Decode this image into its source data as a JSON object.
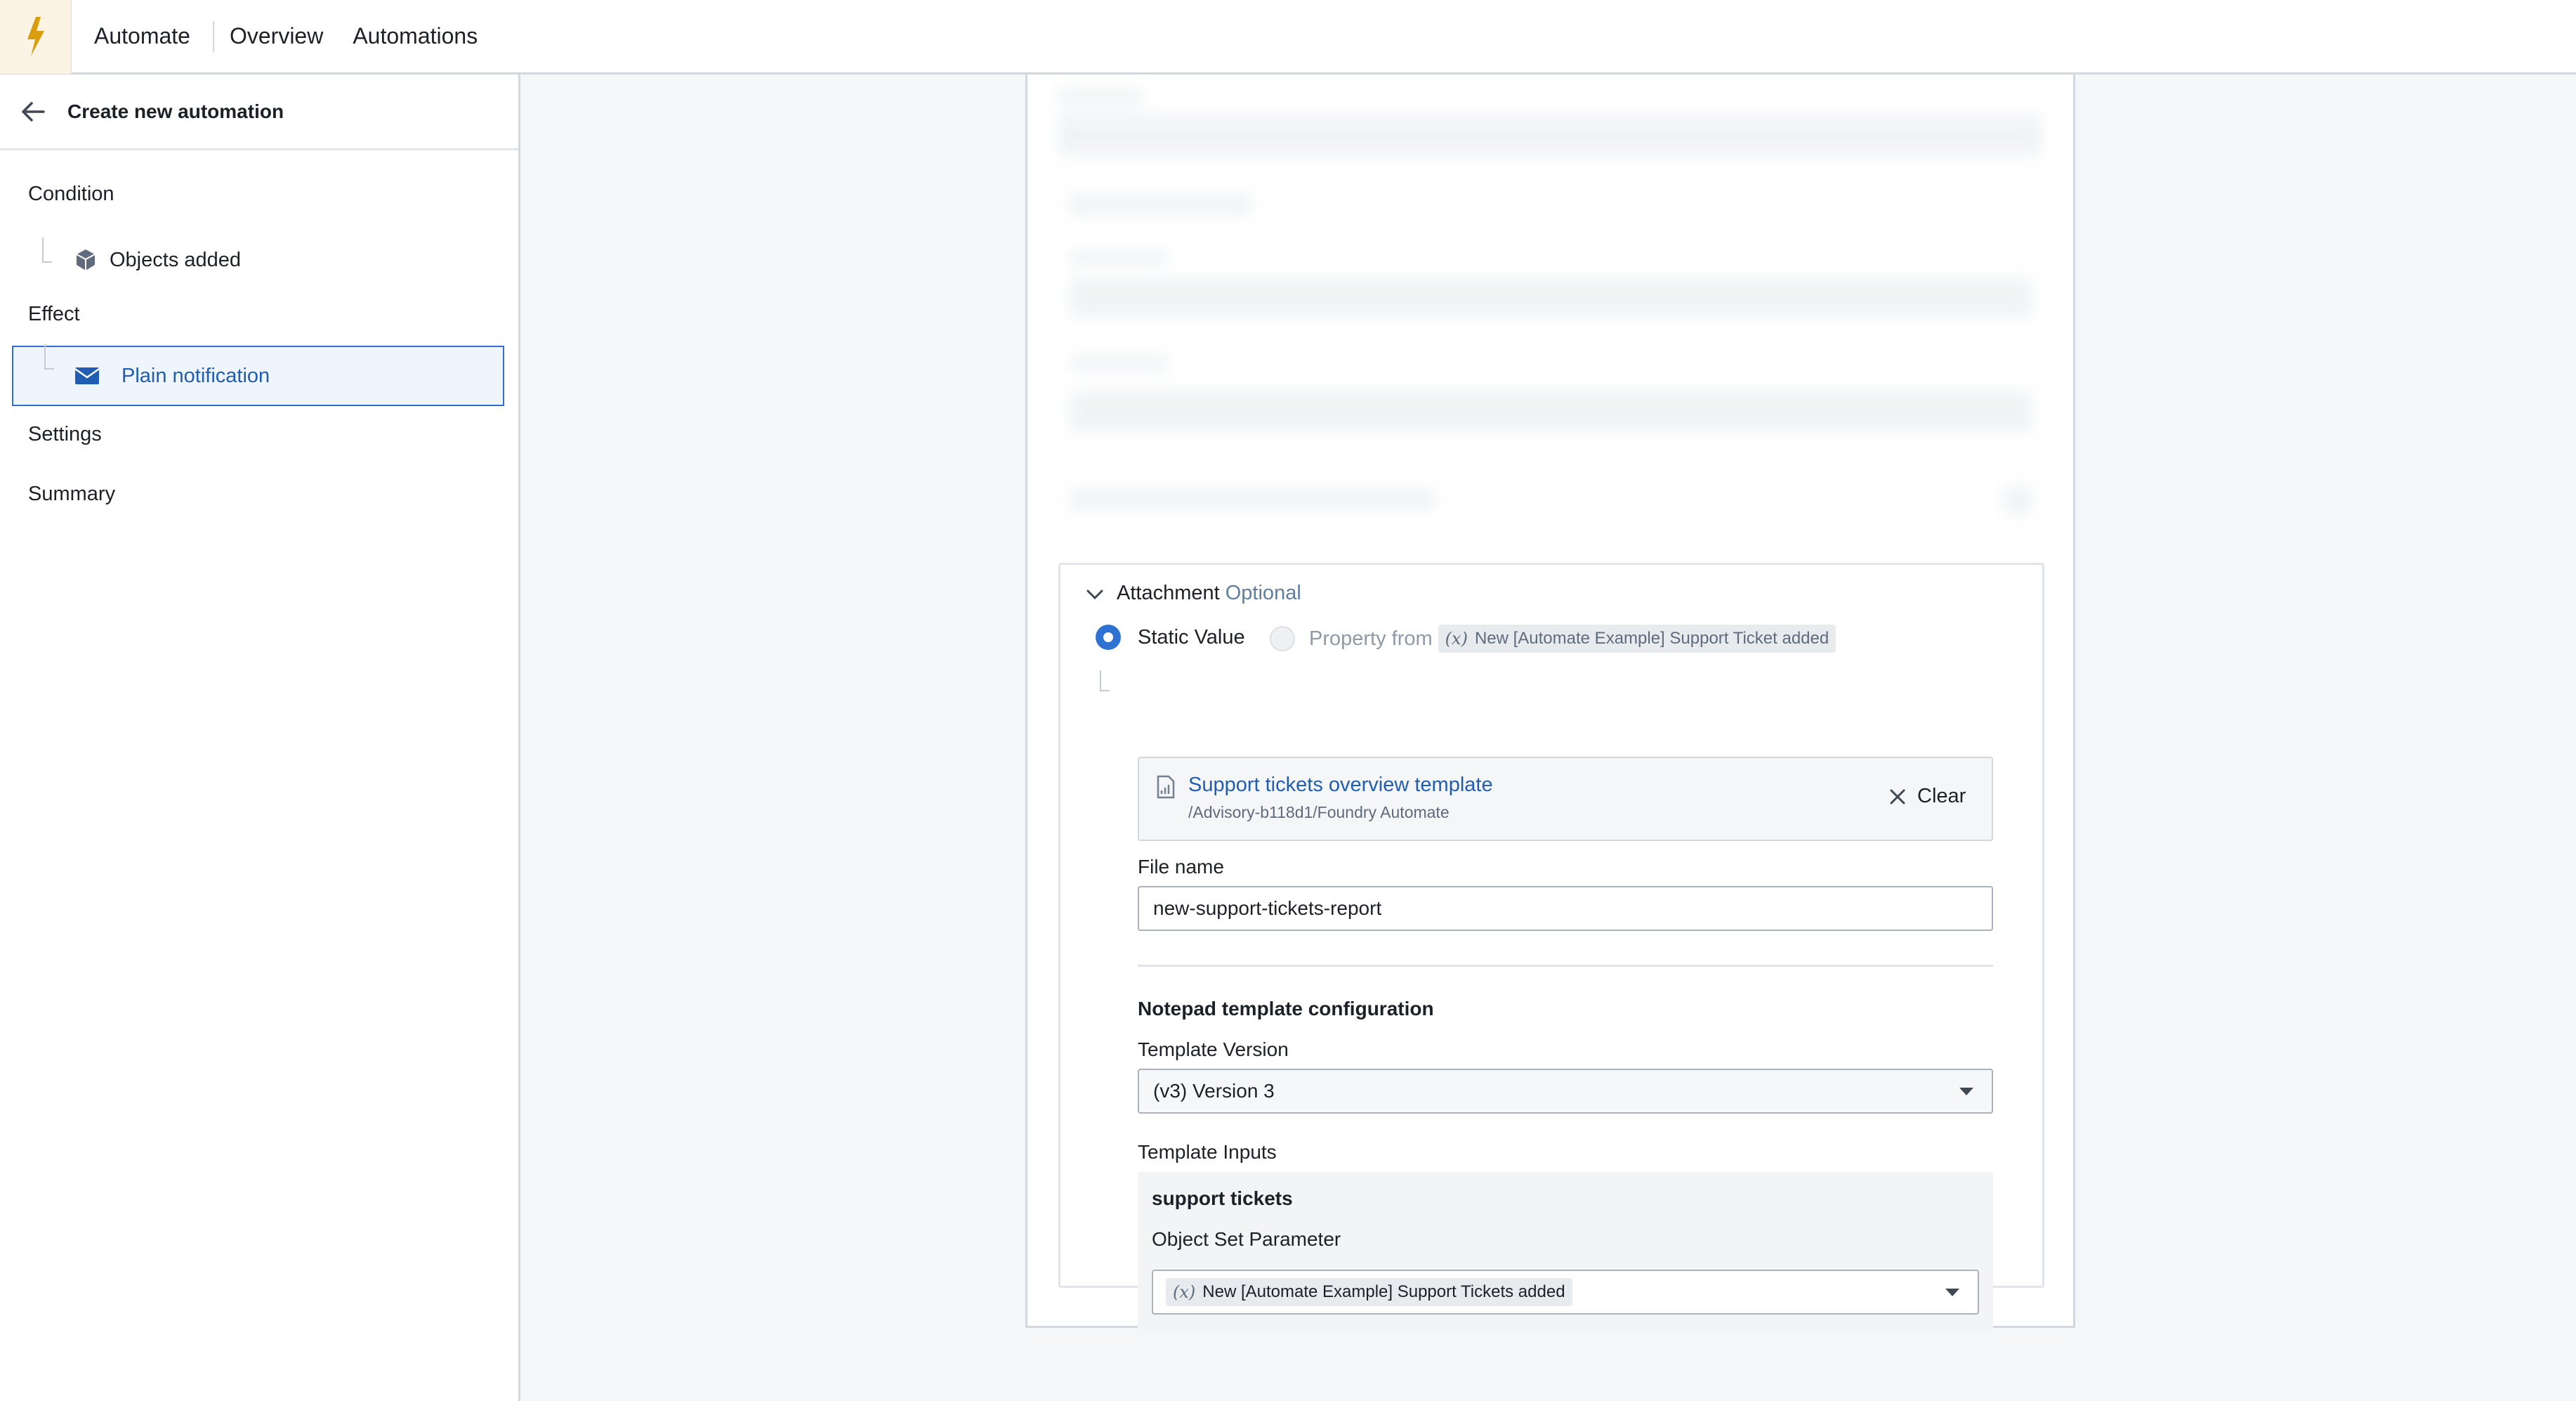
{
  "topbar": {
    "app_name": "Automate",
    "nav": [
      "Overview",
      "Automations"
    ]
  },
  "sidebar": {
    "title": "Create new automation",
    "condition_label": "Condition",
    "condition_item": "Objects added",
    "effect_label": "Effect",
    "effect_item": "Plain notification",
    "settings_label": "Settings",
    "summary_label": "Summary"
  },
  "attachment": {
    "title": "Attachment",
    "optional": "Optional",
    "radio_static": "Static Value",
    "radio_property": "Property from",
    "property_tag": "New [Automate Example] Support Ticket added",
    "variable_glyph": "(x)",
    "file": {
      "name": "Support tickets overview template",
      "path": "/Advisory-b118d1/Foundry Automate",
      "clear_label": "Clear"
    },
    "file_name_label": "File name",
    "file_name_value": "new-support-tickets-report",
    "config_heading": "Notepad template configuration",
    "template_version_label": "Template Version",
    "template_version_value": "(v3) Version 3",
    "template_inputs_label": "Template Inputs",
    "input_group_title": "support tickets",
    "object_set_label": "Object Set Parameter",
    "object_set_value": "New [Automate Example] Support Tickets added"
  },
  "colors": {
    "accent": "#2d72d2",
    "selected_bg": "#eef5fd",
    "link": "#215db0",
    "logo_bg": "#fbf3e4",
    "logo_bolt": "#d99e0b"
  },
  "icons": {
    "logo": "lightning-bolt-icon",
    "back": "arrow-left-icon",
    "objects": "cube-icon",
    "notification": "envelope-icon",
    "collapse": "chevron-down-icon",
    "file": "document-icon",
    "clear": "close-icon",
    "dropdown": "caret-down-icon"
  }
}
